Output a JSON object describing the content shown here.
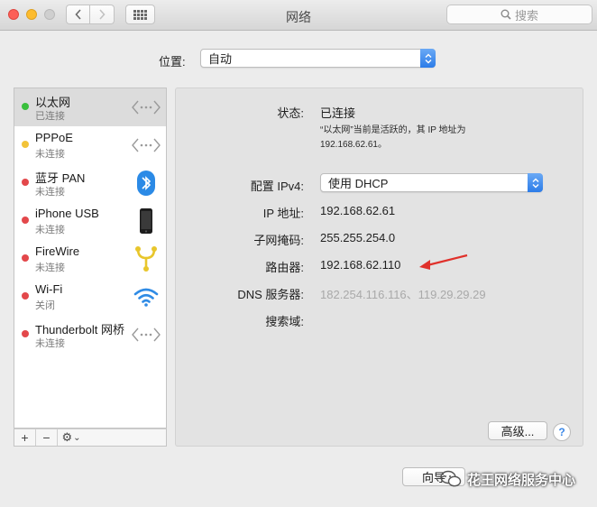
{
  "window": {
    "title": "网络",
    "search_placeholder": "搜索"
  },
  "location": {
    "label": "位置:",
    "value": "自动"
  },
  "services": [
    {
      "name": "以太网",
      "status": "已连接",
      "status_color": "#39bf3c",
      "icon": "ethernet-icon"
    },
    {
      "name": "PPPoE",
      "status": "未连接",
      "status_color": "#f2c339",
      "icon": "ethernet-icon"
    },
    {
      "name": "蓝牙 PAN",
      "status": "未连接",
      "status_color": "#e3484b",
      "icon": "bluetooth-icon"
    },
    {
      "name": "iPhone USB",
      "status": "未连接",
      "status_color": "#e3484b",
      "icon": "iphone-icon"
    },
    {
      "name": "FireWire",
      "status": "未连接",
      "status_color": "#e3484b",
      "icon": "firewire-icon"
    },
    {
      "name": "Wi-Fi",
      "status": "关闭",
      "status_color": "#e3484b",
      "icon": "wifi-icon"
    },
    {
      "name": "Thunderbolt 网桥",
      "status": "未连接",
      "status_color": "#e3484b",
      "icon": "ethernet-icon"
    }
  ],
  "sidebar_tools": {
    "add": "+",
    "remove": "−",
    "gear": "⚙",
    "gear_arrow": "⌄"
  },
  "detail": {
    "status_label": "状态:",
    "status_value": "已连接",
    "status_note_line1": "“以太网”当前是活跃的，其 IP 地址为",
    "status_note_line2": "192.168.62.61。",
    "ipv4_label": "配置 IPv4:",
    "ipv4_value": "使用 DHCP",
    "ip_label": "IP 地址:",
    "ip_value": "192.168.62.61",
    "subnet_label": "子网掩码:",
    "subnet_value": "255.255.254.0",
    "router_label": "路由器:",
    "router_value": "192.168.62.110",
    "dns_label": "DNS 服务器:",
    "dns_value": "182.254.116.116、119.29.29.29",
    "search_domain_label": "搜索域:",
    "advanced_button": "高级...",
    "help_button": "?"
  },
  "bottom": {
    "assist_button": "向导"
  },
  "watermark": {
    "text": "花王网络服务中心"
  },
  "colors": {
    "accent_blue": "#2c7ce8",
    "annotation_red": "#e0312b"
  }
}
